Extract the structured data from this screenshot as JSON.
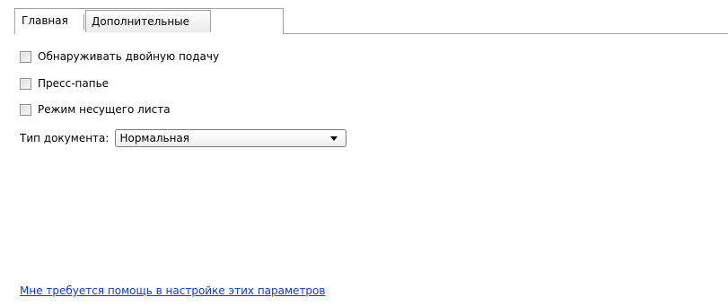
{
  "tabs": [
    {
      "label": "Главная",
      "active": true
    },
    {
      "label": "Дополнительные",
      "active": false
    }
  ],
  "options": [
    {
      "label": "Обнаруживать двойную подачу",
      "checked": false
    },
    {
      "label": "Пресс-папье",
      "checked": false
    },
    {
      "label": "Режим несущего листа",
      "checked": false
    }
  ],
  "document_type": {
    "label": "Тип документа:",
    "value": "Нормальная"
  },
  "help_link": "Мне требуется помощь в настройке этих параметров",
  "colors": {
    "link": "#0b3bcc",
    "border": "#a0a0a0"
  }
}
